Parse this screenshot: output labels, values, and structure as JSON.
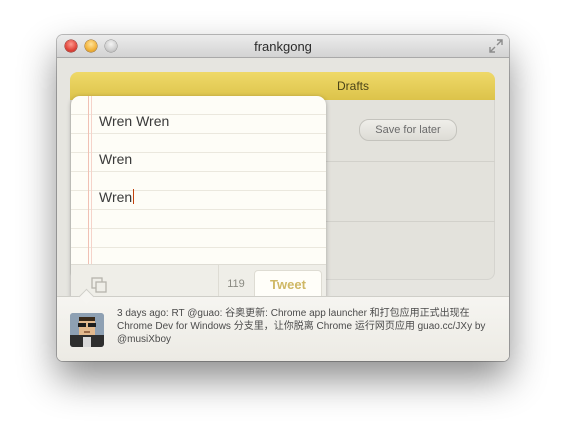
{
  "window": {
    "title": "frankgong"
  },
  "compose": {
    "lines": [
      "Wren Wren",
      "Wren",
      "Wren"
    ],
    "char_count": "119",
    "tweet_label": "Tweet"
  },
  "sidebar": {
    "tab_label": "Drafts",
    "save_label": "Save for later"
  },
  "footer": {
    "status_text": "3 days ago: RT @guao: 谷奥更新: Chrome app launcher 和打包应用正式出现在 Chrome Dev for Windows 分支里，让你脱离 Chrome 运行网页应用 guao.cc/JXy by @musiXboy"
  },
  "icons": {
    "close": "close-traffic-light-icon",
    "minimize": "minimize-traffic-light-icon",
    "zoom": "zoom-traffic-light-icon",
    "fullscreen": "fullscreen-arrows-icon",
    "copy": "copy-stack-icon"
  },
  "colors": {
    "accent_yellow": "#e6cf55",
    "tweet_text": "#cfb865",
    "caret": "#c2410c"
  }
}
